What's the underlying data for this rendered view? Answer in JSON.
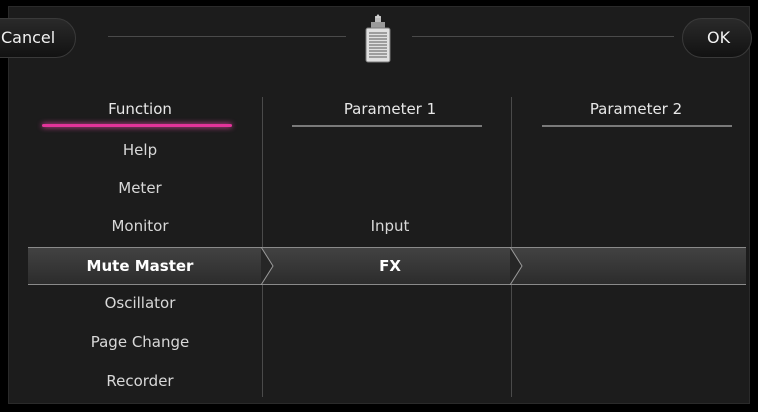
{
  "buttons": {
    "cancel_label": "Cancel",
    "ok_label": "OK"
  },
  "columns": {
    "function_header": "Function",
    "parameter1_header": "Parameter 1",
    "parameter2_header": "Parameter 2"
  },
  "function_list": {
    "items": [
      "Help",
      "Meter",
      "Monitor",
      "Mute Master",
      "Oscillator",
      "Page Change",
      "Recorder"
    ],
    "selected": "Mute Master"
  },
  "parameter1_list": {
    "items": [
      "Input",
      "FX"
    ],
    "selected": "FX"
  },
  "icons": {
    "header_icon": "footswitch-pedal-icon"
  },
  "colors": {
    "active_underline": "#e2349a",
    "background": "#1c1c1c",
    "selection_row": "#383838"
  }
}
